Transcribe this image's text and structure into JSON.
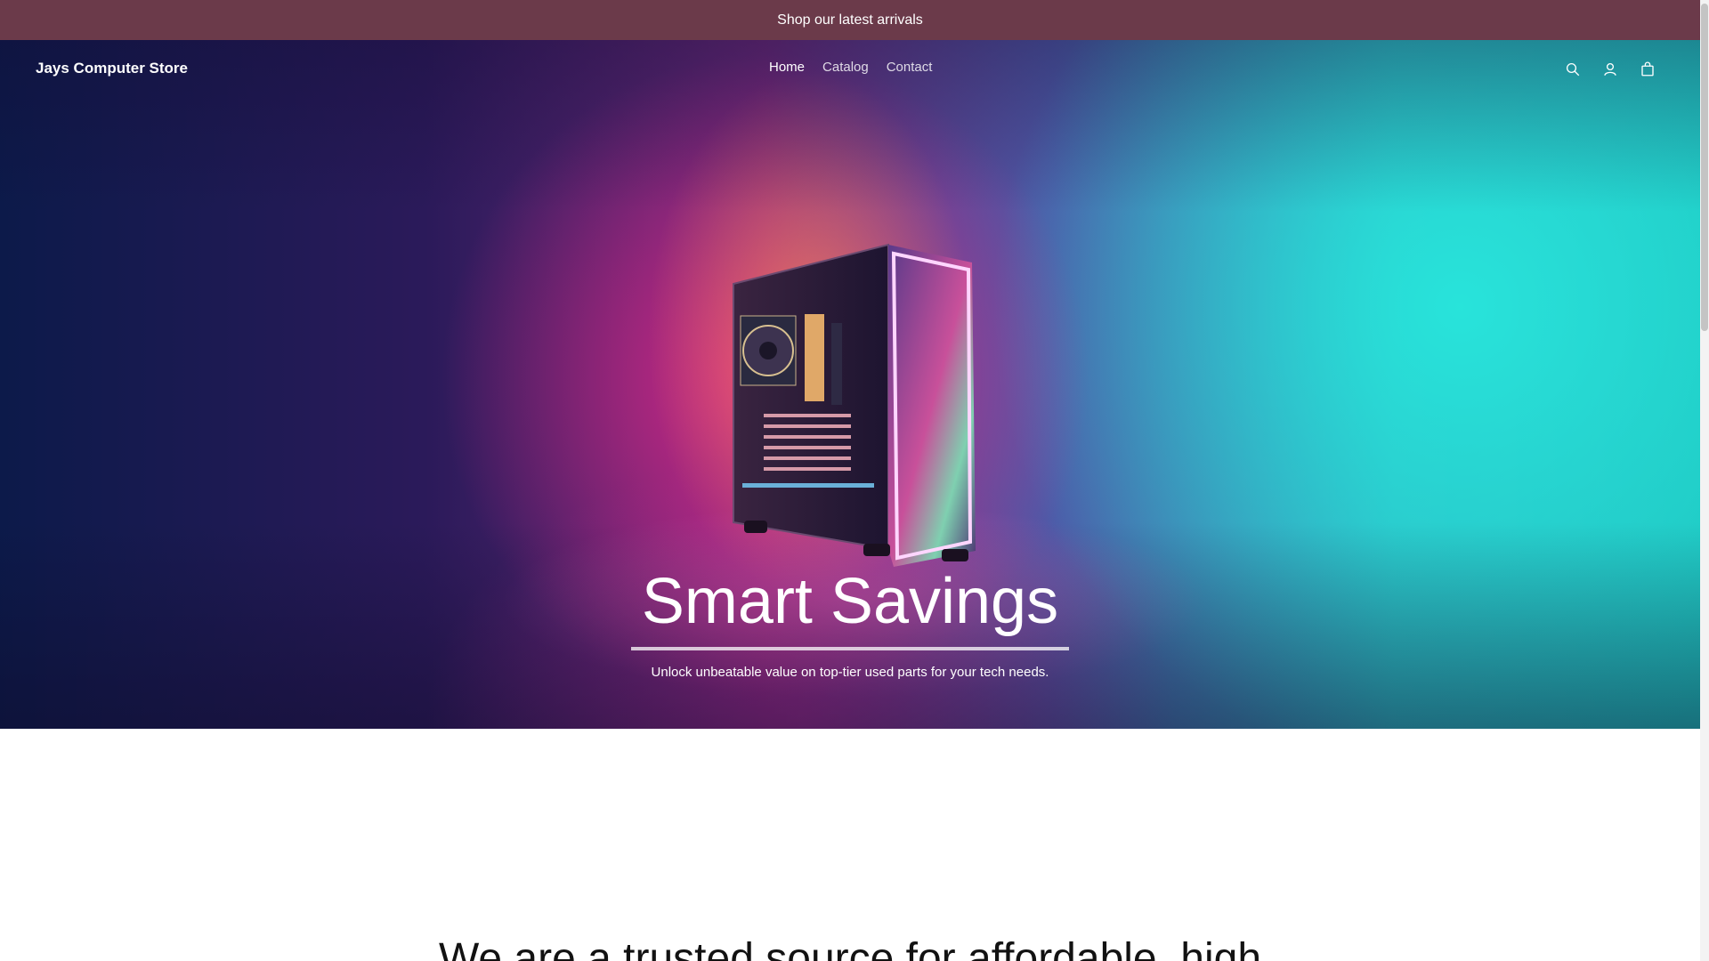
{
  "announcement": {
    "text": "Shop our latest arrivals"
  },
  "header": {
    "brand": "Jays Computer Store",
    "nav": [
      {
        "label": "Home",
        "active": true
      },
      {
        "label": "Catalog",
        "active": false
      },
      {
        "label": "Contact",
        "active": false
      }
    ],
    "icons": [
      "search-icon",
      "account-icon",
      "cart-icon"
    ]
  },
  "hero": {
    "title": "Smart Savings",
    "subtitle": "Unlock unbeatable value on top-tier used parts for your tech needs."
  },
  "intro": {
    "text": "We are a trusted source for affordable, high"
  },
  "colors": {
    "announcement_bg": "#6b3a4a",
    "hero_pink": "#ff288c",
    "hero_teal": "#28e6dc",
    "hero_navy": "#0c1a4a"
  }
}
